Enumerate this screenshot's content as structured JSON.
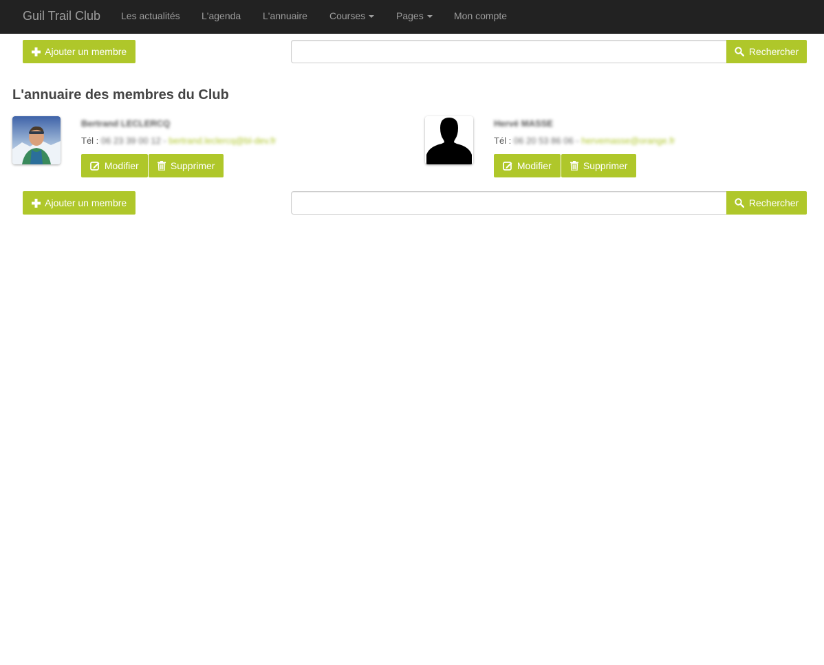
{
  "navbar": {
    "brand": "Guil Trail Club",
    "items": [
      {
        "label": "Les actualités"
      },
      {
        "label": "L'agenda"
      },
      {
        "label": "L'annuaire"
      },
      {
        "label": "Courses"
      },
      {
        "label": "Pages"
      },
      {
        "label": "Mon compte"
      }
    ]
  },
  "actions": {
    "add_member_label": "Ajouter un membre",
    "search_label": "Rechercher",
    "search_value": ""
  },
  "page": {
    "title": "L'annuaire des membres du Club"
  },
  "members": [
    {
      "name": "Bertrand LECLERCQ",
      "tel_label": "Tél :",
      "phone": "06 23 39 00 12",
      "separator": "-",
      "email": "bertrand.leclercq@bl-dev.fr",
      "edit_label": "Modifier",
      "delete_label": "Supprimer"
    },
    {
      "name": "Hervé MASSE",
      "tel_label": "Tél :",
      "phone": "06 20 53 86 06",
      "separator": "-",
      "email": "hervemasse@orange.fr",
      "edit_label": "Modifier",
      "delete_label": "Supprimer"
    }
  ],
  "colors": {
    "accent": "#afc72a",
    "navbar_bg": "#222222",
    "navbar_text": "#9d9d9d"
  },
  "icons": {
    "add": "plus-icon",
    "search": "search-icon",
    "edit": "edit-icon",
    "delete": "trash-icon"
  }
}
